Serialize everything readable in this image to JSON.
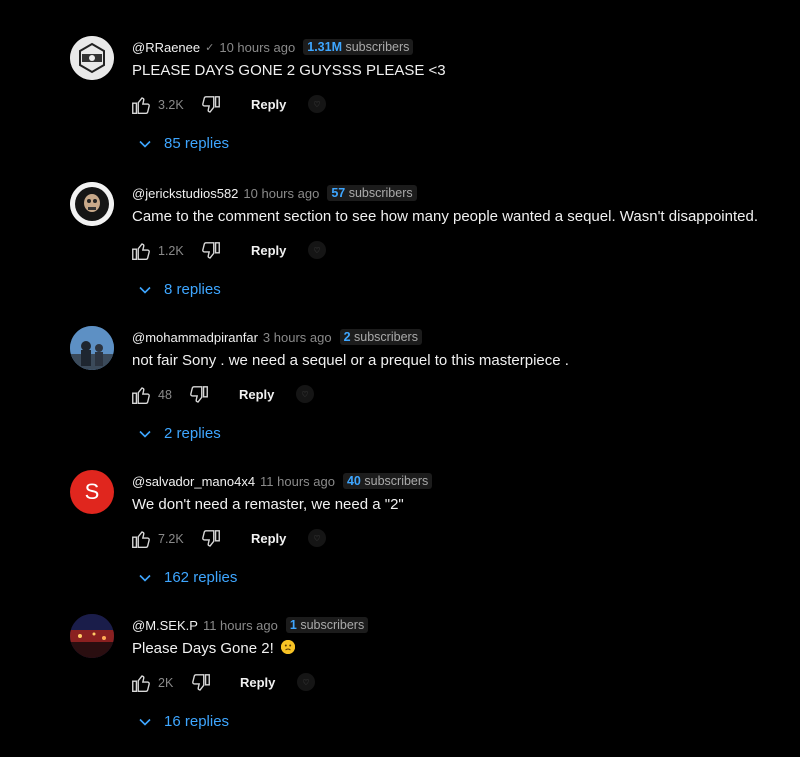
{
  "comments": [
    {
      "handle": "@RRaenee",
      "verified_mark": "✓",
      "time": "10 hours ago",
      "subs_num": "1.31M",
      "subs_word": "subscribers",
      "text": "PLEASE DAYS GONE 2 GUYSSS PLEASE <3",
      "likes": "3.2K",
      "reply_label": "Reply",
      "replies": "85 replies"
    },
    {
      "handle": "@jerickstudios582",
      "time": "10 hours ago",
      "subs_num": "57",
      "subs_word": "subscribers",
      "text": "Came to the comment section to see how many people wanted a sequel. Wasn't disappointed.",
      "likes": "1.2K",
      "reply_label": "Reply",
      "replies": "8 replies"
    },
    {
      "handle": "@mohammadpiranfar",
      "time": "3 hours ago",
      "subs_num": "2",
      "subs_word": "subscribers",
      "text": "not fair Sony . we need a sequel or a prequel to this masterpiece .",
      "likes": "48",
      "reply_label": "Reply",
      "replies": "2 replies"
    },
    {
      "handle": "@salvador_mano4x4",
      "avatar_letter": "S",
      "time": "11 hours ago",
      "subs_num": "40",
      "subs_word": "subscribers",
      "text": "We don't need a remaster, we need a \"2\"",
      "likes": "7.2K",
      "reply_label": "Reply",
      "replies": "162 replies"
    },
    {
      "handle": "@M.SEK.P",
      "time": "11 hours ago",
      "subs_num": "1",
      "subs_word": "subscribers",
      "text": "Please Days Gone 2!",
      "likes": "2K",
      "reply_label": "Reply",
      "replies": "16 replies"
    }
  ],
  "colors": {
    "accent": "#3ea6ff",
    "background": "#000000",
    "muted": "#8a8a8a",
    "avatar_s": "#e0261e"
  }
}
